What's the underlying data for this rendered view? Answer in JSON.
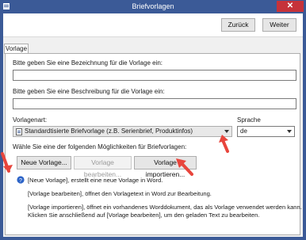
{
  "window": {
    "title": "Briefvorlagen",
    "close_glyph": "✕"
  },
  "toolbar": {
    "back_label": "Zurück",
    "next_label": "Weiter"
  },
  "tabs": [
    {
      "label": "Vorlage"
    }
  ],
  "form": {
    "name_label": "Bitte geben Sie eine Bezeichnung für die Vorlage ein:",
    "name_value": "",
    "description_label": "Bitte geben Sie eine Beschreibung für die Vorlage ein:",
    "description_value": "",
    "template_type_label": "Vorlagenart:",
    "template_type_value": "Standardtisierte Briefvorlage (z.B. Serienbrief, Produktinfos)",
    "language_label": "Sprache",
    "language_value": "de",
    "options_label": "Wähle Sie eine der folgenden Möglichkeiten für Briefvorlagen:"
  },
  "actions": {
    "new_label": "Neue Vorlage...",
    "edit_label": "Vorlage bearbeiten...",
    "import_label": "Vorlage importieren..."
  },
  "info": {
    "line1": "[Neue Vorlage], erstellt eine neue Vorlage in Word.",
    "line2": "[Vorlage bearbeiten], öffnet den Vorlagetext in Word zur Bearbeitung.",
    "line3": "[Vorlage importieren], öffnet ein vorhandenes Worddokument, das als Vorlage verwendet werden kann.",
    "line4": "Klicken Sie anschließend auf [Vorlage bearbeiten], um den geladen Text zu bearbeiten."
  },
  "colors": {
    "titlebar": "#3b5a97",
    "close": "#c6323a",
    "annotation_arrow": "#e8453c"
  },
  "icons": [
    "app-icon",
    "close-icon",
    "template-icon",
    "chevron-down-icon",
    "info-icon"
  ]
}
